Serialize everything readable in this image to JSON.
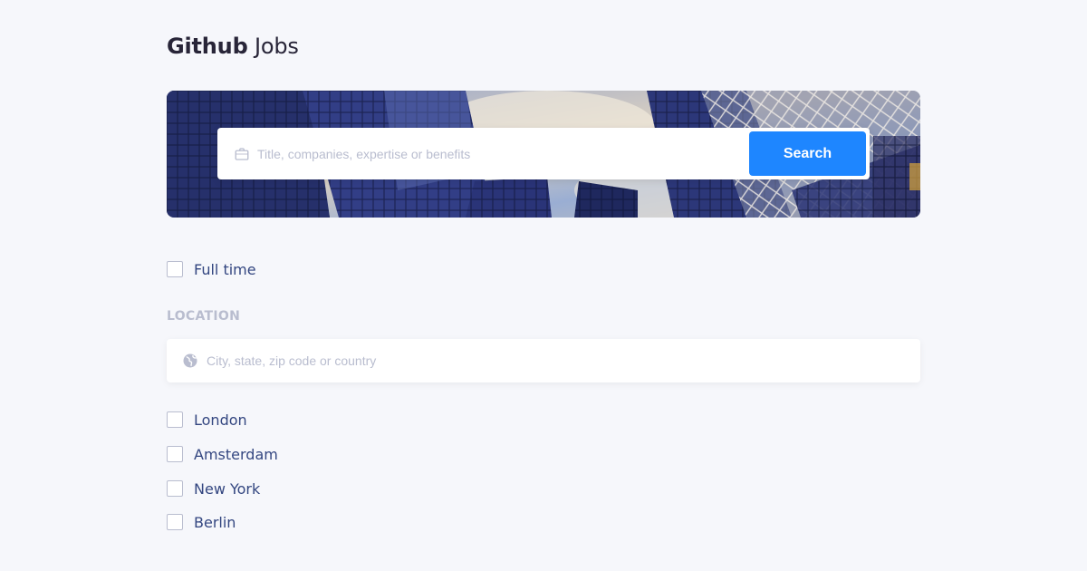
{
  "brand": {
    "bold": "Github",
    "light": "Jobs"
  },
  "search": {
    "placeholder": "Title, companies, expertise or benefits",
    "button_label": "Search",
    "icon": "briefcase-icon"
  },
  "filters": {
    "full_time": {
      "label": "Full time",
      "checked": false
    }
  },
  "location": {
    "title": "LOCATION",
    "placeholder": "City, state, zip code or country",
    "icon": "globe-icon",
    "options": [
      {
        "label": "London",
        "checked": false
      },
      {
        "label": "Amsterdam",
        "checked": false
      },
      {
        "label": "New York",
        "checked": false
      },
      {
        "label": "Berlin",
        "checked": false
      }
    ]
  },
  "colors": {
    "accent": "#1E86FF",
    "background": "#F6F7FB",
    "text": "#334680",
    "muted": "#B9BDCF",
    "brand_text": "#282538"
  }
}
